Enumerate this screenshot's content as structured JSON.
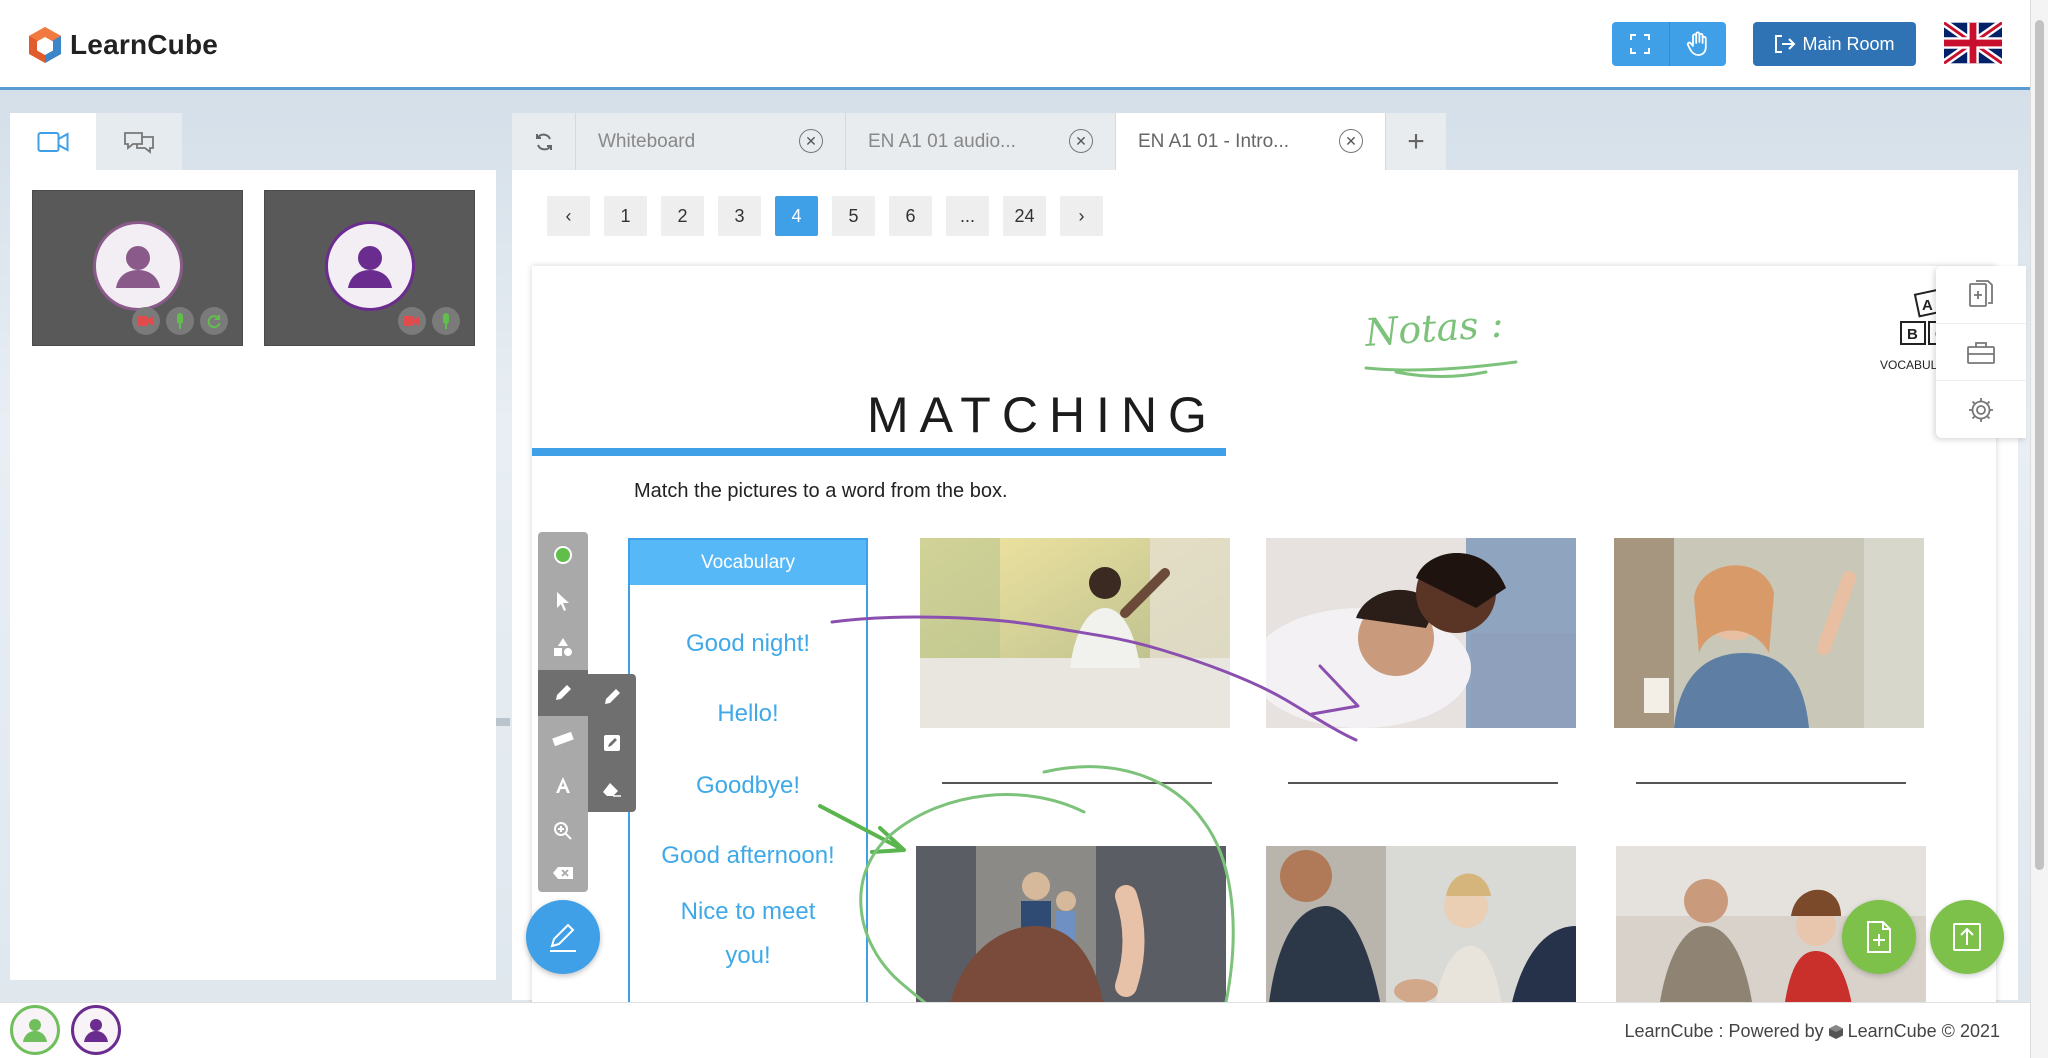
{
  "app": {
    "name": "LearnCube",
    "accent": "#3fa0e8",
    "header_button_color": "#2f73b5"
  },
  "header": {
    "fullscreen_icon": "fullscreen-icon",
    "raise_hand_icon": "hand-icon",
    "main_room_label": "Main Room",
    "language_flag": "uk-flag"
  },
  "left_panel": {
    "tabs": [
      {
        "icon": "video-camera-icon",
        "active": true
      },
      {
        "icon": "chat-bubbles-icon",
        "active": false
      }
    ],
    "participants": [
      {
        "avatar_color": "#8a5a8a",
        "controls": [
          "camera-off-icon",
          "mic-icon",
          "refresh-icon"
        ]
      },
      {
        "avatar_color": "#6b2c8f",
        "controls": [
          "camera-off-icon",
          "mic-icon"
        ]
      }
    ]
  },
  "workspace": {
    "tabs": [
      {
        "label": "Whiteboard",
        "active": false
      },
      {
        "label": "EN A1 01 audio...",
        "active": false
      },
      {
        "label": "EN A1 01 - Intro...",
        "active": true
      }
    ],
    "pagination": {
      "pages": [
        "1",
        "2",
        "3",
        "4",
        "5",
        "6",
        "...",
        "24"
      ],
      "current": "4",
      "prev": "‹",
      "next": "›"
    }
  },
  "slide": {
    "title": "MATCHING",
    "instruction": "Match the pictures to a word from the box.",
    "vocab_header": "Vocabulary",
    "vocab_words": [
      "Good night!",
      "Hello!",
      "Goodbye!",
      "Good afternoon!",
      "Nice to meet",
      "you!"
    ],
    "corner_caption": "VOCABUL",
    "abc_letters": [
      "A",
      "B",
      "C"
    ],
    "handwritten_note": "Notas :"
  },
  "toolbar": {
    "tools": [
      "color-dot-icon",
      "pointer-icon",
      "shapes-icon",
      "pencil-icon",
      "ruler-icon",
      "text-icon",
      "zoom-icon",
      "clear-icon"
    ],
    "submenu": [
      "pencil-icon",
      "highlighter-icon",
      "eraser-icon"
    ]
  },
  "float_menu": [
    "add-page-icon",
    "toolbox-icon",
    "settings-icon"
  ],
  "footer": {
    "text": "LearnCube : Powered by",
    "brand": "LearnCube © 2021"
  },
  "annotations": {
    "purple": "#8b4fb0",
    "green": "#6fbf5c"
  }
}
